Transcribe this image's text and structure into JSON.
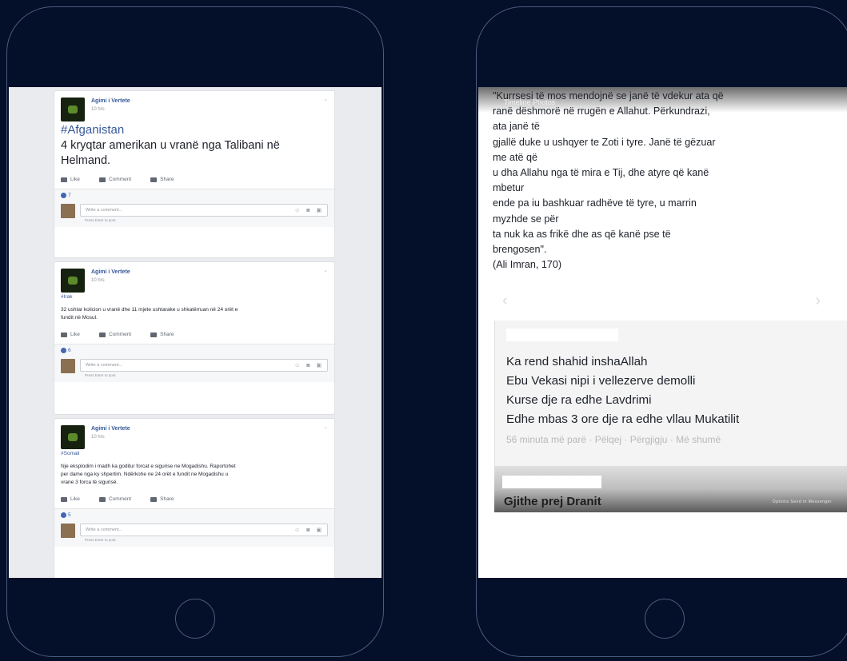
{
  "left_phone": {
    "posts": [
      {
        "author": "Agimi i Vertete",
        "time": "10 hrs",
        "tag": "#Afganistan",
        "text": [
          "4 kryqtar amerikan u vranë nga Talibani në",
          "Helmand."
        ],
        "reactions_count": "7",
        "comment_placeholder": "Write a comment...",
        "enter_hint": "Press Enter to post."
      },
      {
        "author": "Agimi i Vertete",
        "time": "10 hrs",
        "tag": "#Irak",
        "text": [
          "32 ushtar kolicion u vranë dhe 11 mjete ushtarake u shkatërruan në 24 orët e",
          "fundit në Mosul."
        ],
        "reactions_count": "6",
        "comment_placeholder": "Write a comment...",
        "enter_hint": "Press Enter to post."
      },
      {
        "author": "Agimi i Vertete",
        "time": "10 hrs",
        "tag": "#Somali",
        "text": [
          "Nje eksplodim i madh ka goditur forcat e sigurise ne Mogadishu. Raportohet",
          "per dame nga ky shpertim. Ndërkohe ne 24 orët e fundit ne Mogadishu u",
          "vrane 3 forca të sigurisë."
        ],
        "reactions_count": "5",
        "comment_placeholder": "Write a comment...",
        "enter_hint": "Press Enter to post."
      }
    ],
    "actions": {
      "like": "Like",
      "comment": "Comment",
      "share": "Share"
    }
  },
  "right_phone": {
    "photo_label": "Timeline Photos",
    "quote_lines": [
      "\"Kurrsesi të mos mendojnë se janë të vdekur ata që",
      "ranë dëshmorë në rrugën e Allahut. Përkundrazi,",
      "ata janë të",
      "gjallë duke u ushqyer te Zoti i tyre. Janë të gëzuar",
      "me atë që",
      "u dha Allahu nga të mira e Tij, dhe atyre që kanë",
      "mbetur",
      "ende pa iu bashkuar radhëve të tyre, u marrin",
      "myzhde se për",
      "ta nuk ka as frikë dhe as që kanë pse të",
      "brengosen\".",
      "(Ali Imran, 170)"
    ],
    "comment_lines": [
      "Ka rend shahid inshaAllah",
      "Ebu Vekasi nipi i vellezerve demolli",
      "Kurse dje ra edhe Lavdrimi",
      "Edhe mbas 3 ore dje ra edhe vllau Mukatilit"
    ],
    "comment_meta": "56 minuta më parë · Pëlqej · Përgjigju · Më shumë",
    "bottom_name": "Gjithe prej Dranit",
    "bottom_links": "Options    Send in Messenger"
  }
}
